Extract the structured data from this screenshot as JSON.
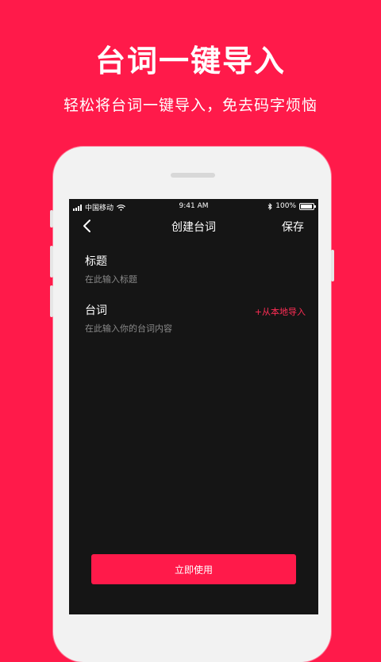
{
  "promo": {
    "headline": "台词一键导入",
    "subline": "轻松将台词一键导入，免去码字烦恼"
  },
  "status_bar": {
    "carrier": "中国移动",
    "time": "9:41 AM",
    "battery": "100%",
    "icons": [
      "signal-icon",
      "wifi-icon",
      "bluetooth-icon",
      "battery-icon"
    ]
  },
  "nav": {
    "back_icon": "chevron-left-icon",
    "title": "创建台词",
    "save_label": "保存"
  },
  "form": {
    "title_label": "标题",
    "title_placeholder": "在此输入标题",
    "content_label": "台词",
    "content_placeholder": "在此输入你的台词内容",
    "import_label": "+从本地导入"
  },
  "cta_label": "立即使用",
  "colors": {
    "brand": "#ff1a4a",
    "screen_bg": "#151515",
    "accent_text": "#ff2d55"
  }
}
